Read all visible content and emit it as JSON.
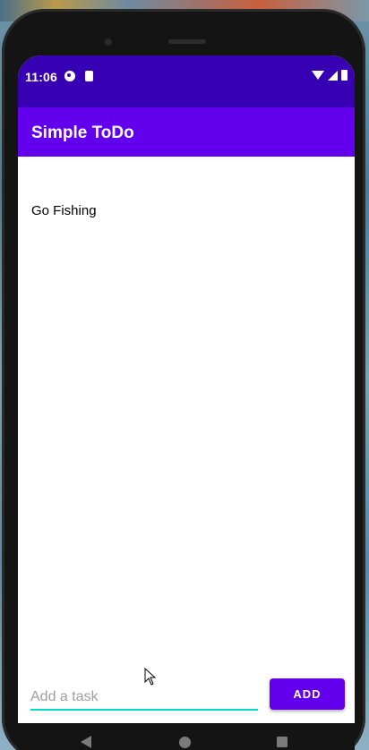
{
  "status_bar": {
    "time": "11:06"
  },
  "app_bar": {
    "title": "Simple ToDo"
  },
  "tasks": [
    {
      "label": "Go Fishing"
    }
  ],
  "input": {
    "placeholder": "Add a task",
    "value": ""
  },
  "add_button": {
    "label": "ADD"
  },
  "colors": {
    "status_bar": "#3700b3",
    "app_bar": "#6200ee",
    "accent": "#03dac5"
  },
  "icons": {
    "status_left": [
      "notification-icon",
      "sd-card-icon"
    ],
    "status_right": [
      "wifi-icon",
      "cell-signal-icon",
      "battery-icon"
    ],
    "nav": [
      "back-icon",
      "home-icon",
      "recents-icon"
    ]
  }
}
